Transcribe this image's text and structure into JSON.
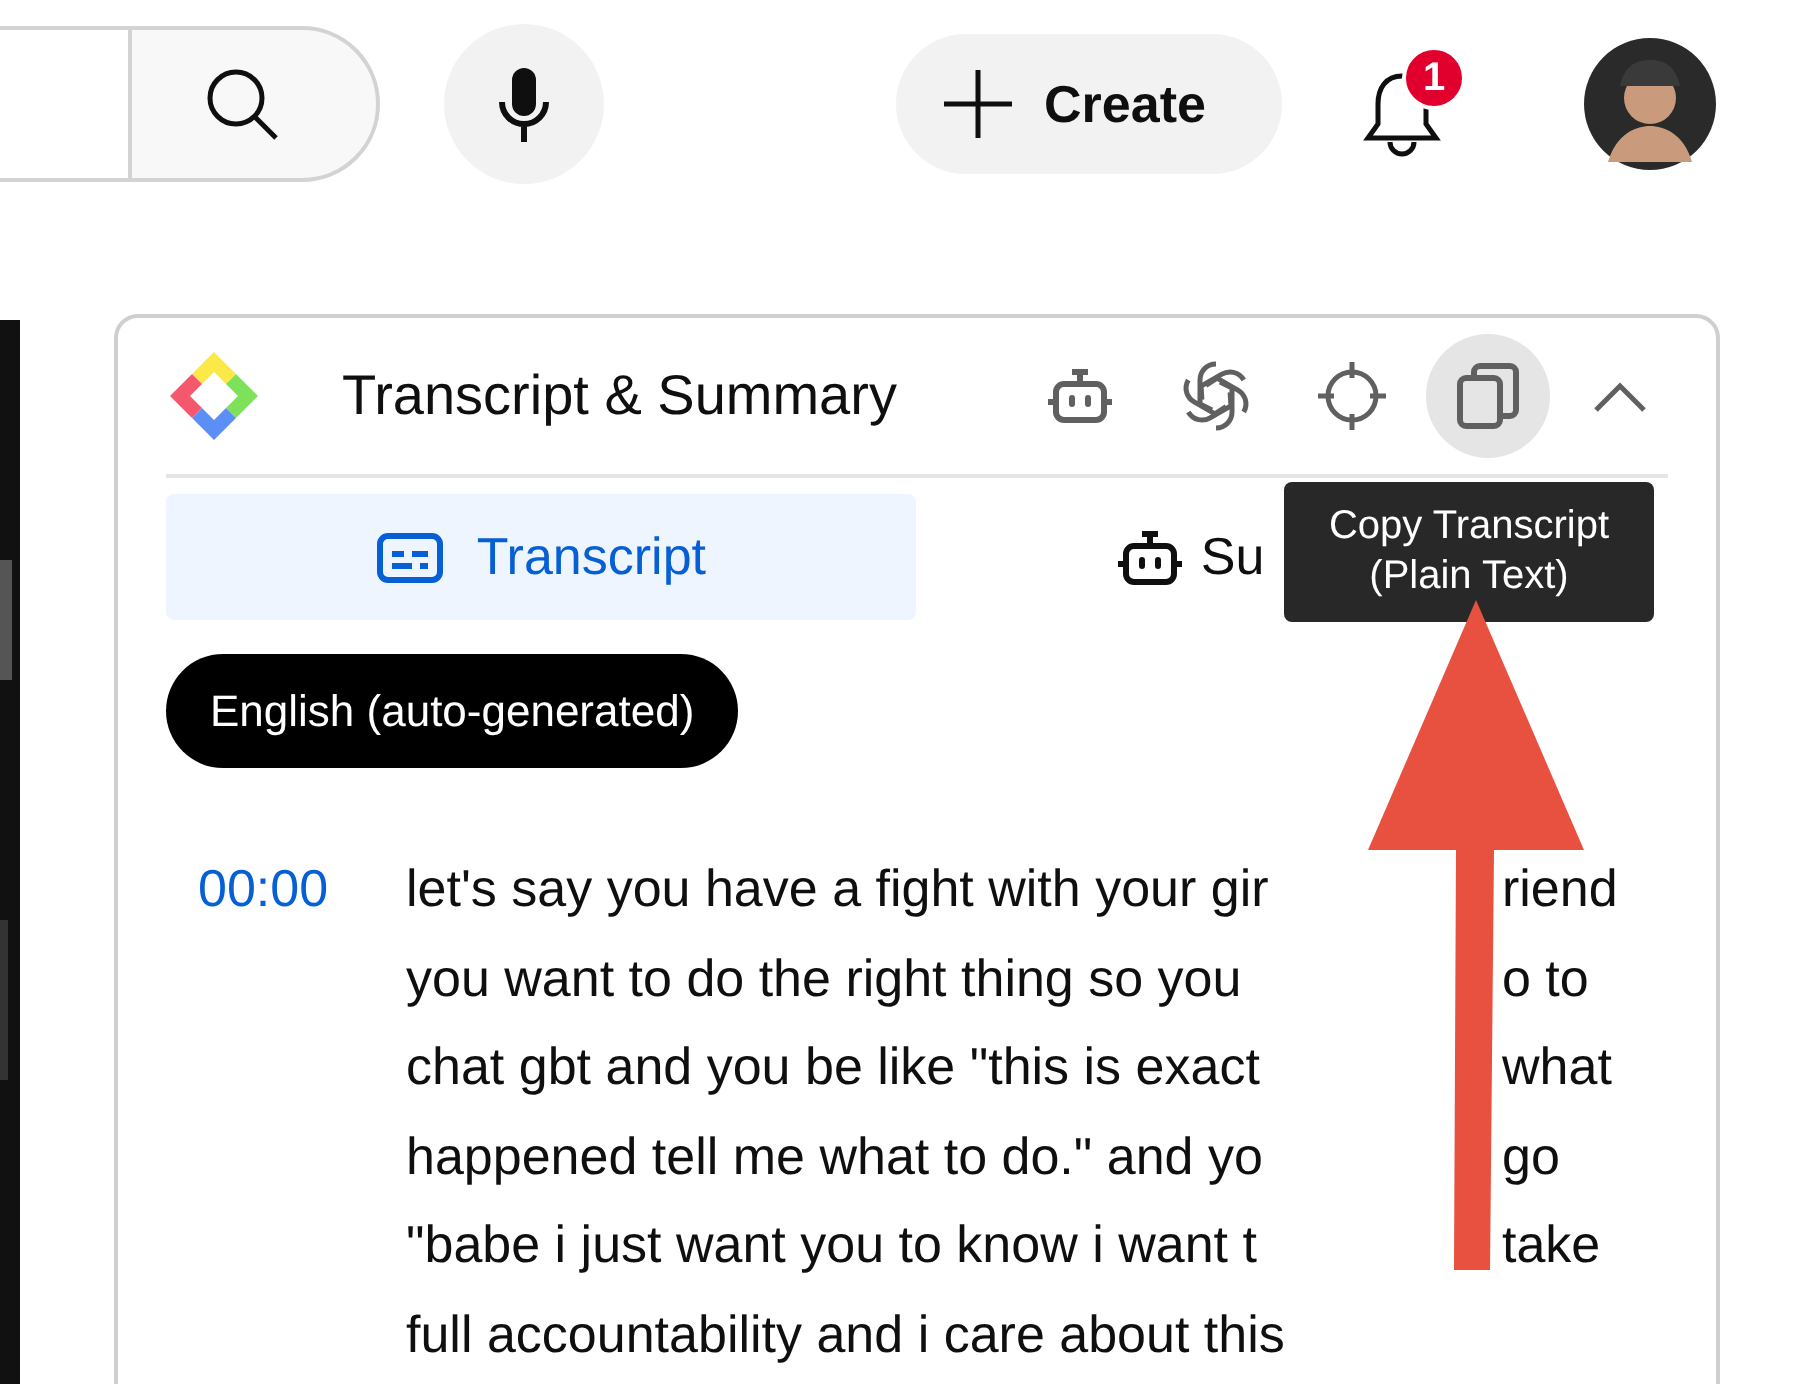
{
  "header": {
    "create_label": "Create",
    "notification_count": "1"
  },
  "panel": {
    "title": "Transcript & Summary",
    "tools": [
      {
        "kind": "bot",
        "active": false
      },
      {
        "kind": "openai",
        "active": false
      },
      {
        "kind": "target",
        "active": false
      },
      {
        "kind": "copy",
        "active": true
      }
    ],
    "tabs": [
      {
        "kind": "transcript",
        "label": "Transcript",
        "selected": true
      },
      {
        "kind": "bot",
        "label": "Su",
        "selected": false
      }
    ],
    "tooltip": {
      "lines": [
        "Copy Transcript",
        "(Plain Text)"
      ]
    },
    "language": "English (auto-generated)",
    "transcript": {
      "timestamp": "00:00",
      "lines": [
        {
          "text": "let's say you have a fight with your gir",
          "after_arrow": "riend"
        },
        {
          "text": "you want to do the right thing so you",
          "after_arrow": "o to"
        },
        {
          "text": "chat gbt and you be like \"this is exact",
          "after_arrow": "what"
        },
        {
          "text": "happened tell me what to do.\" and yo",
          "after_arrow": "go"
        },
        {
          "text": "\"babe i just want you to know i want t",
          "after_arrow": "take"
        },
        {
          "text": "full accountability and i care about this"
        }
      ]
    }
  }
}
